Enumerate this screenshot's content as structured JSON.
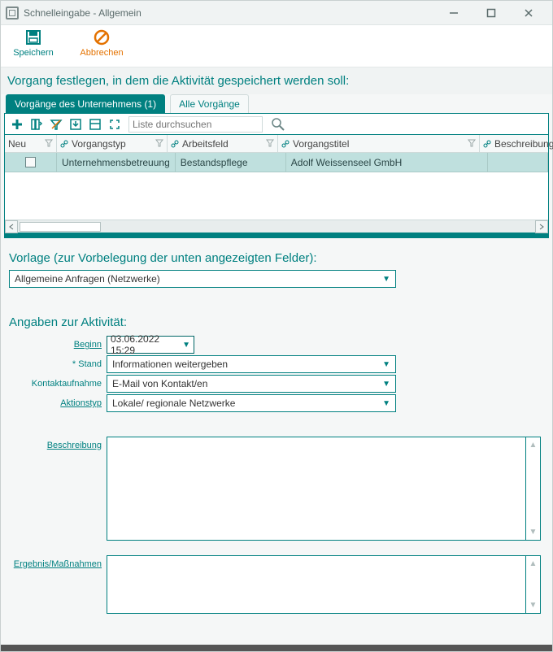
{
  "window": {
    "title": "Schnelleingabe - Allgemein"
  },
  "toolbar": {
    "save_label": "Speichern",
    "cancel_label": "Abbrechen"
  },
  "section_select_vorgang": "Vorgang festlegen, in dem die Aktivität gespeichert werden soll:",
  "tabs": {
    "company": "Vorgänge des Unternehmens (1)",
    "all": "Alle Vorgänge"
  },
  "grid_toolbar": {
    "search_placeholder": "Liste durchsuchen"
  },
  "grid": {
    "columns": {
      "neu": "Neu",
      "vorgangstyp": "Vorgangstyp",
      "arbeitsfeld": "Arbeitsfeld",
      "vorgangstitel": "Vorgangstitel",
      "beschreibung": "Beschreibung"
    },
    "rows": [
      {
        "vorgangstyp": "Unternehmensbetreuung",
        "arbeitsfeld": "Bestandspflege",
        "vorgangstitel": "Adolf Weissenseel GmbH"
      }
    ]
  },
  "vorlage": {
    "title": "Vorlage (zur Vorbelegung der unten angezeigten Felder):",
    "selected": "Allgemeine Anfragen (Netzwerke)"
  },
  "activity": {
    "title": "Angaben zur Aktivität:",
    "labels": {
      "beginn": "Beginn",
      "stand": "* Stand",
      "kontakt": "Kontaktaufnahme",
      "aktionstyp": "Aktionstyp",
      "beschreibung": "Beschreibung",
      "ergebnis": "Ergebnis/Maßnahmen"
    },
    "values": {
      "beginn": "03.06.2022 15:29",
      "stand": "Informationen weitergeben",
      "kontakt": "E-Mail von Kontakt/en",
      "aktionstyp": "Lokale/ regionale Netzwerke",
      "beschreibung": "",
      "ergebnis": ""
    }
  }
}
